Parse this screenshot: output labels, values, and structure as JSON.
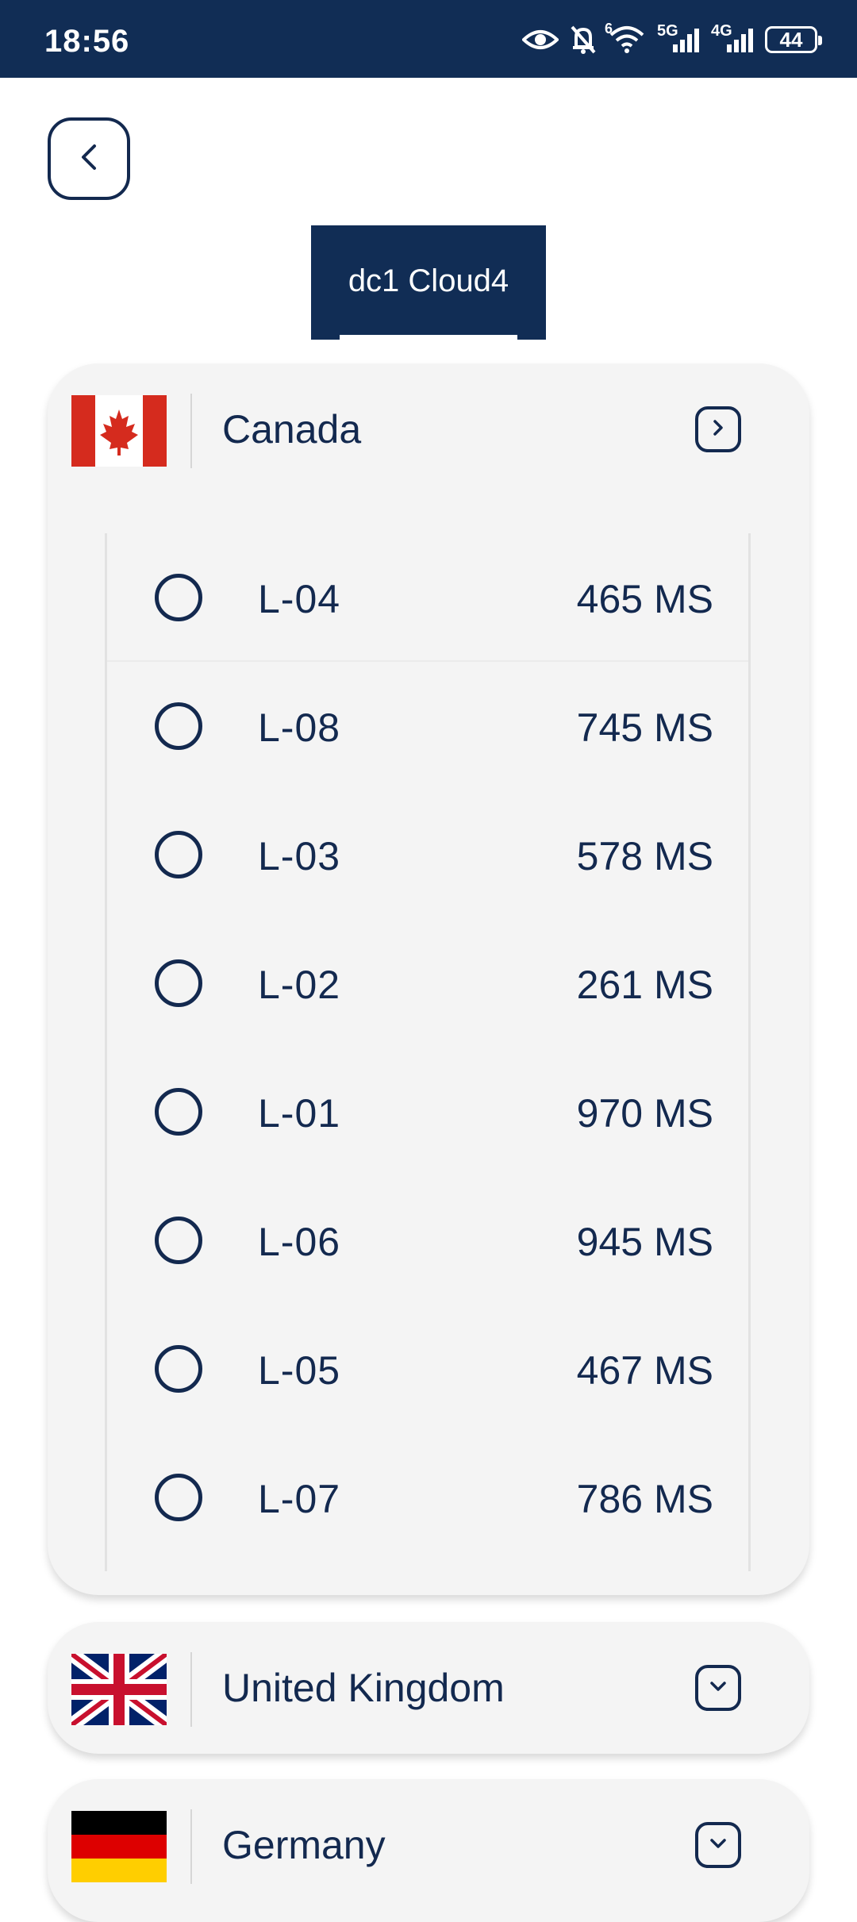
{
  "status_bar": {
    "time": "18:56",
    "icons": [
      "eye-icon",
      "bell-off-icon",
      "wifi-6-icon",
      "signal-5g-icon",
      "signal-4g-icon"
    ],
    "network_5g": "5G",
    "network_4g": "4G",
    "wifi_label": "6",
    "battery": "44"
  },
  "header": {
    "back_icon": "chevron-left-icon",
    "tab_label": "dc1 Cloud4"
  },
  "countries": [
    {
      "name": "Canada",
      "flag": "canada-flag",
      "expanded": true,
      "servers": [
        {
          "name": "L-04",
          "ping": "465 MS"
        },
        {
          "name": "L-08",
          "ping": "745 MS"
        },
        {
          "name": "L-03",
          "ping": "578 MS"
        },
        {
          "name": "L-02",
          "ping": "261 MS"
        },
        {
          "name": "L-01",
          "ping": "970 MS"
        },
        {
          "name": "L-06",
          "ping": "945 MS"
        },
        {
          "name": "L-05",
          "ping": "467 MS"
        },
        {
          "name": "L-07",
          "ping": "786 MS"
        }
      ]
    },
    {
      "name": "United Kingdom",
      "flag": "uk-flag",
      "expanded": false
    },
    {
      "name": "Germany",
      "flag": "germany-flag",
      "expanded": false
    }
  ],
  "colors": {
    "primary": "#112d55",
    "text": "#13294f",
    "card_bg": "#f4f4f4"
  }
}
